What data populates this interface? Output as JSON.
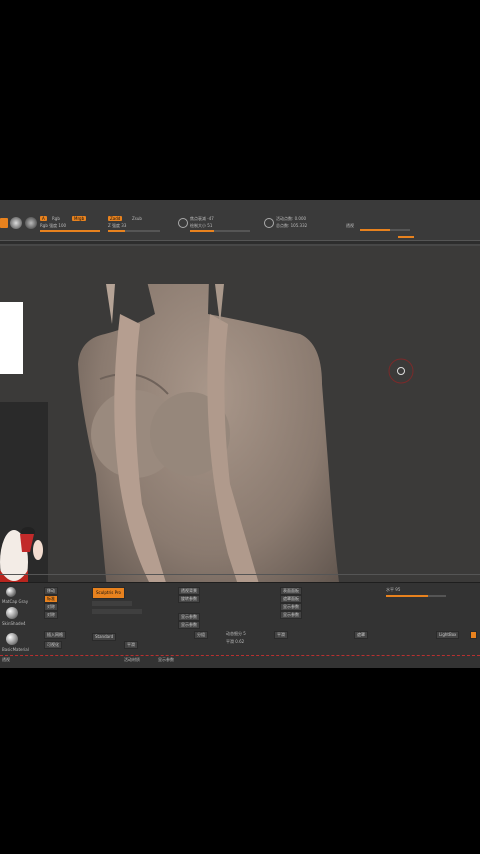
{
  "toolbar": {
    "rgb_label": "Rgb",
    "mrgb_label": "Mrgb",
    "rgb_intensity": "Rgb 强度 100",
    "zadd": "Zadd",
    "zsub": "Zsub",
    "z_intensity": "Z 强度 33",
    "focal_shift": "焦点衰减 -47",
    "draw_size": "绘制大小 51",
    "active_points": "活动点数: 0.000",
    "total_points": "总点数: 105.332",
    "perspective": "透视"
  },
  "bottom": {
    "lightbox": "LightBox",
    "standard": "Standard",
    "sculptris_pro": "Sculptris Pro",
    "col2": [
      "移动",
      "标准",
      "对称",
      "对称"
    ],
    "col3": [
      "透视背景",
      "旋转参数",
      "显示参数",
      "显示参数"
    ],
    "col4": [
      "表面面板",
      "遮罩面板",
      "显示参数",
      "显示参数"
    ],
    "col5": [
      "插入网格",
      "可视化",
      "平滑"
    ],
    "col6": [
      "分组",
      "平滑",
      "遮罩"
    ],
    "sliders": [
      "动态细分 5",
      "平滑 0.62",
      "水平 95"
    ],
    "material_labels": [
      "MatCap Gray",
      "SkinShade4",
      "BasicMaterial"
    ],
    "footer": [
      "透视",
      "活动材质",
      "显示参数"
    ]
  }
}
